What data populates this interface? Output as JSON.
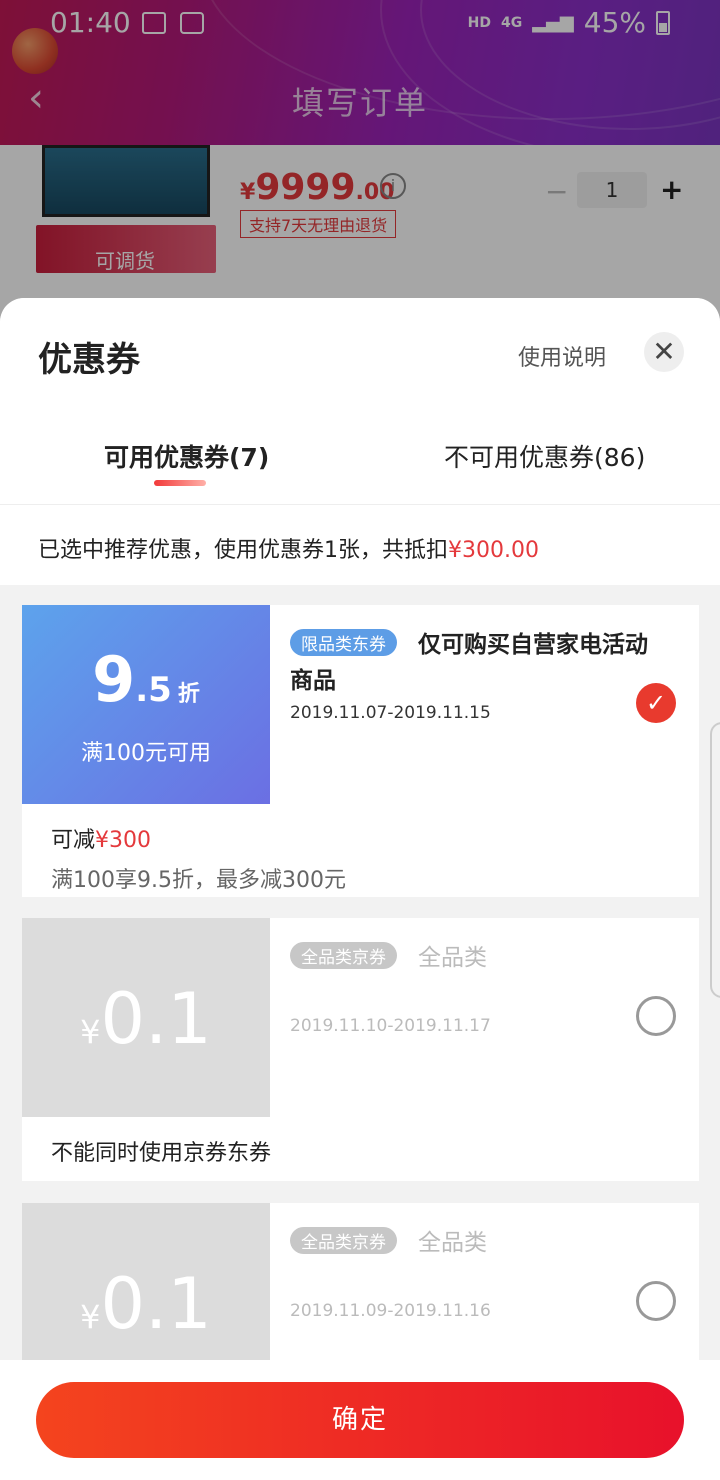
{
  "status_bar": {
    "time": "01:40",
    "network": "HD",
    "signal": "4G",
    "battery": "45%"
  },
  "header": {
    "title": "填写订单"
  },
  "order_peek": {
    "price_symbol": "¥",
    "price_int": "9999",
    "price_dec": ".00",
    "return_policy": "支持7天无理由退货",
    "adjust_label": "可调货",
    "quantity": "1"
  },
  "sheet": {
    "title": "优惠券",
    "usage_link": "使用说明",
    "tabs": [
      {
        "label": "可用优惠券(7)",
        "active": true
      },
      {
        "label": "不可用优惠券(86)",
        "active": false
      }
    ],
    "summary_prefix": "已选中推荐优惠，使用优惠券1张，共抵扣",
    "summary_amount": "¥300.00"
  },
  "coupons": [
    {
      "discount_int": "9",
      "discount_dec": ".5",
      "discount_unit": "折",
      "min_spend": "满100元可用",
      "badge": "限品类东券",
      "description": "仅可购买自营家电活动商品",
      "date_range": "2019.11.07-2019.11.15",
      "selected": true,
      "foot_prefix": "可减",
      "foot_amount": "¥300",
      "foot_detail": "满100享9.5折，最多减300元"
    },
    {
      "amount_symbol": "¥",
      "amount": "0.1",
      "badge": "全品类京券",
      "description": "全品类",
      "date_range": "2019.11.10-2019.11.17",
      "selected": false,
      "foot_note": "不能同时使用京券东券"
    },
    {
      "amount_symbol": "¥",
      "amount": "0.1",
      "badge": "全品类京券",
      "description": "全品类",
      "date_range": "2019.11.09-2019.11.16",
      "selected": false
    }
  ],
  "confirm_label": "确定",
  "icons": {
    "back": "chevron-left-icon",
    "close": "close-icon",
    "check": "check-circle-icon",
    "info": "info-icon"
  },
  "colors": {
    "accent_red": "#e4393c",
    "coupon_blue": "#5d9de6",
    "button_red": "#f4441e"
  }
}
